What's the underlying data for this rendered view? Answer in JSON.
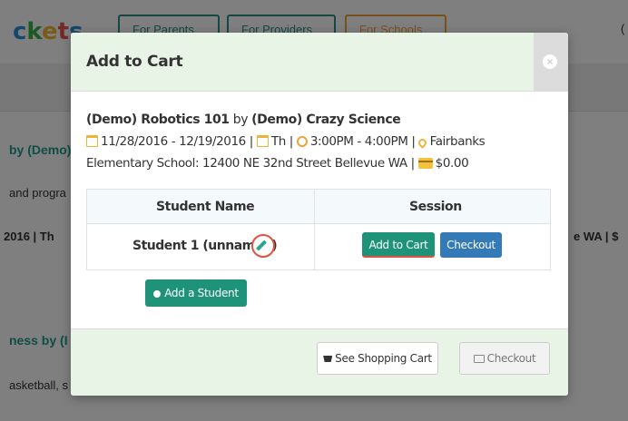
{
  "background": {
    "logo": "ckets",
    "nav": [
      "For Parents ⌄",
      "For Providers ⌄",
      "For Schools ⌄"
    ],
    "right_edge": "(",
    "left_snippets": [
      "by (Demo)",
      "and progra",
      "2016 | ",
      "Th",
      "ness by (I",
      "asketball, s"
    ],
    "right_snippets": [
      "e WA |",
      "$"
    ]
  },
  "modal": {
    "title": "Add to Cart",
    "close_glyph": "×",
    "course": {
      "name": "(Demo) Robotics 101",
      "by_word": "by",
      "provider": "(Demo) Crazy Science",
      "dates": "11/28/2016 - 12/19/2016",
      "day": "Th",
      "time": "3:00PM - 4:00PM",
      "location_start": "Fairbanks",
      "location_rest": "Elementary School: 12400 NE 32nd Street Bellevue WA",
      "price": "$0.00",
      "separator": "|"
    },
    "table": {
      "headers": [
        "Student Name",
        "Session"
      ],
      "rows": [
        {
          "student": "Student 1 (unnamed)",
          "add_label": "Add to Cart",
          "checkout_label": "Checkout"
        }
      ]
    },
    "add_student_label": "Add a Student",
    "footer": {
      "cart_label": "See Shopping Cart",
      "checkout_label": "Checkout"
    }
  },
  "colors": {
    "teal": "#1f9379",
    "blue": "#337ab7",
    "highlight": "#e0523e",
    "header_bg": "#e8f4e6",
    "icon_orange": "#f0b23a"
  }
}
